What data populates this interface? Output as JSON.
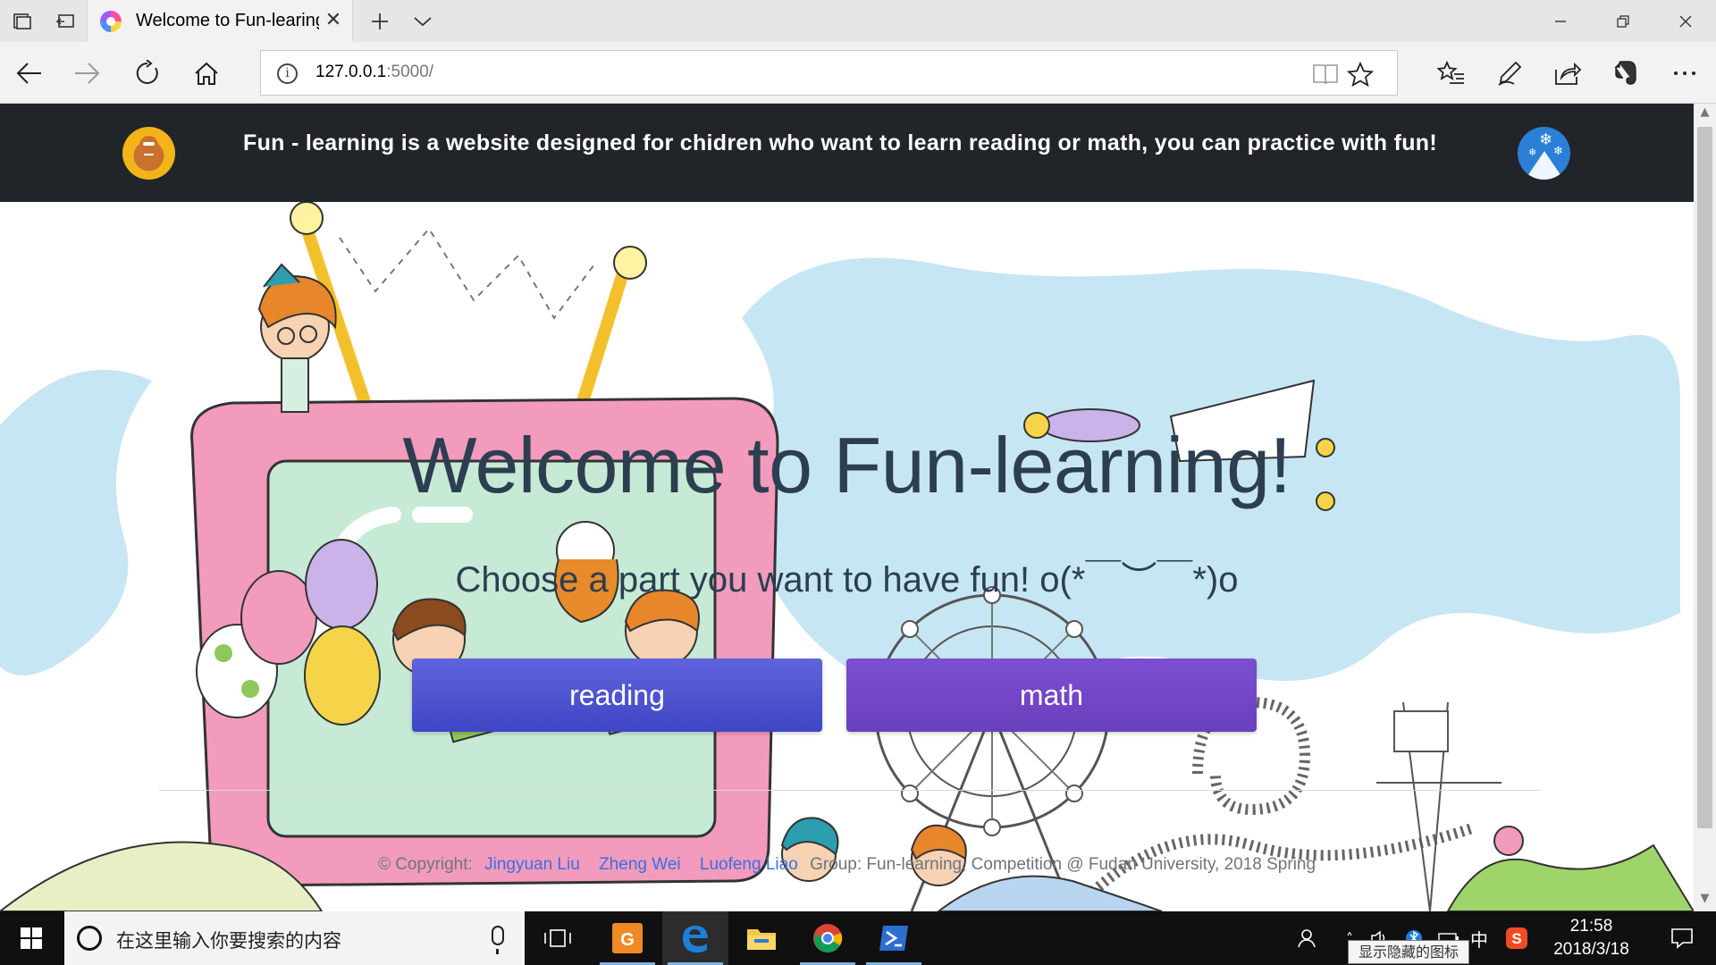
{
  "viewport": {
    "width": 1920,
    "height": 1080
  },
  "browser": {
    "tab": {
      "title": "Welcome to Fun-learing",
      "favicon": "pinwheel-favicon"
    },
    "url": {
      "host": "127.0.0.1",
      "rest": ":5000/"
    },
    "buttons": [
      "tabs-aside-icon",
      "set-aside-icon",
      "close-tab-icon",
      "new-tab-icon",
      "tab-list-icon",
      "minimize-icon",
      "restore-icon",
      "close-window-icon",
      "back-icon",
      "forward-icon",
      "refresh-icon",
      "home-icon",
      "info-icon",
      "reading-view-icon",
      "favorite-star-icon",
      "favorites-hub-icon",
      "pen-icon",
      "share-icon",
      "evernote-icon",
      "more-icon"
    ]
  },
  "header": {
    "text": "Fun - learning is a website designed for chidren who want to learn reading or math, you can practice with fun!",
    "logo_left": "gingerbread-logo",
    "logo_right": "snow-mountain-logo",
    "bg_color": "#212529"
  },
  "hero": {
    "title": "Welcome to Fun-learning!",
    "subtitle": "Choose a part you want to have fun! o(*￣︶￣*)o",
    "buttons": {
      "reading": "reading",
      "math": "math"
    },
    "title_color": "#2c3e50"
  },
  "footer": {
    "copyright": "© Copyright:",
    "authors": [
      "Jingyuan Liu",
      "Zheng Wei",
      "Luofeng Liao"
    ],
    "rest": "Group: Fun-learning, Competition @ Fudan University, 2018 Spring"
  },
  "taskbar": {
    "search_placeholder": "在这里输入你要搜索的内容",
    "apps": [
      "task-view-icon",
      "pdf-reader-app-icon",
      "edge-app-icon",
      "file-explorer-app-icon",
      "chrome-app-icon",
      "powershell-app-icon"
    ],
    "tray": {
      "ime": "中",
      "time": "21:58",
      "date": "2018/3/18"
    },
    "tooltip": "显示隐藏的图标"
  },
  "colors": {
    "accent_reading": "#4a50cf",
    "accent_math": "#6f43c4",
    "link": "#3b6fe0"
  }
}
